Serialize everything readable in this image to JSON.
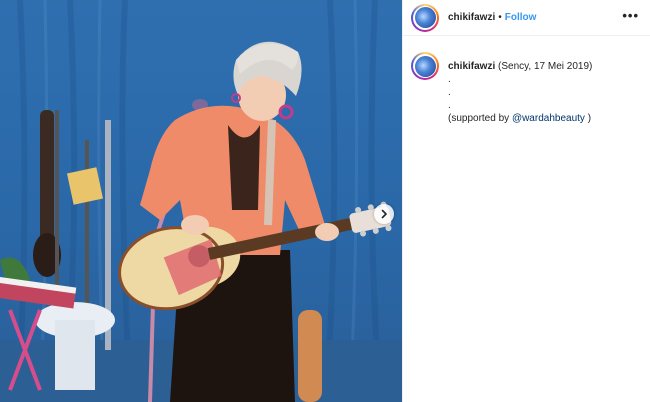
{
  "post": {
    "username": "chikifawzi",
    "follow_label": "Follow",
    "separator": "•",
    "more_label": "•••",
    "caption": {
      "username": "chikifawzi",
      "line1": "(Sency, 17 Mei 2019)",
      "dot_lines": [
        ".",
        ".",
        "."
      ],
      "supported_prefix": "(supported by ",
      "mention": "@wardahbeauty",
      "supported_suffix": " )"
    }
  },
  "icons": {
    "next": "chevron-right-icon",
    "more": "more-options-icon"
  },
  "colors": {
    "follow": "#3897f0",
    "mention": "#003569",
    "backdrop": "#2f6fb0"
  }
}
